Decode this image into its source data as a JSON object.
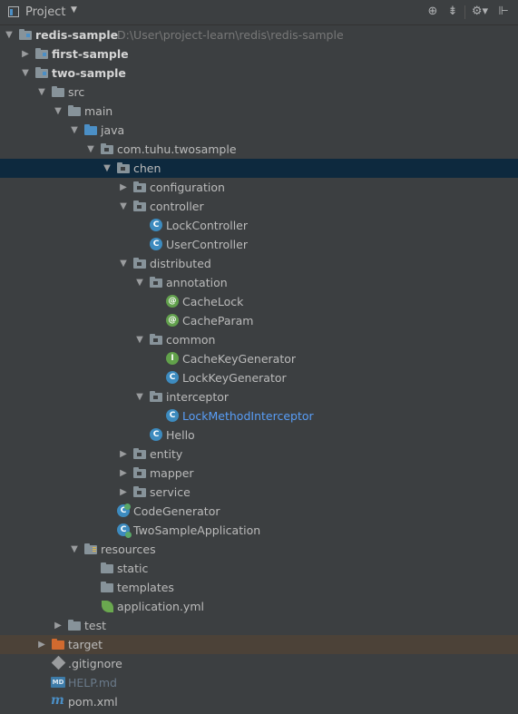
{
  "header": {
    "title": "Project"
  },
  "tree": [
    {
      "label": "redis-sample",
      "hint": "D:\\User\\project-learn\\redis\\redis-sample",
      "bold": true,
      "arrow": "down",
      "icon": "module-folder"
    },
    {
      "label": "first-sample",
      "bold": true,
      "arrow": "right",
      "icon": "module-folder"
    },
    {
      "label": "two-sample",
      "bold": true,
      "arrow": "down",
      "icon": "module-folder"
    },
    {
      "label": "src",
      "arrow": "down",
      "icon": "folder"
    },
    {
      "label": "main",
      "arrow": "down",
      "icon": "folder"
    },
    {
      "label": "java",
      "arrow": "down",
      "icon": "source-folder"
    },
    {
      "label": "com.tuhu.twosample",
      "arrow": "down",
      "icon": "package-icon"
    },
    {
      "label": "chen",
      "arrow": "down",
      "icon": "package-icon",
      "selected": true
    },
    {
      "label": "configuration",
      "arrow": "right",
      "icon": "package-icon"
    },
    {
      "label": "controller",
      "arrow": "down",
      "icon": "package-icon"
    },
    {
      "label": "LockController",
      "icon": "class-icon"
    },
    {
      "label": "UserController",
      "icon": "class-icon"
    },
    {
      "label": "distributed",
      "arrow": "down",
      "icon": "package-icon"
    },
    {
      "label": "annotation",
      "arrow": "down",
      "icon": "package-icon"
    },
    {
      "label": "CacheLock",
      "icon": "annotation-icon"
    },
    {
      "label": "CacheParam",
      "icon": "annotation-icon"
    },
    {
      "label": "common",
      "arrow": "down",
      "icon": "package-icon"
    },
    {
      "label": "CacheKeyGenerator",
      "icon": "interface-icon"
    },
    {
      "label": "LockKeyGenerator",
      "icon": "class-icon"
    },
    {
      "label": "interceptor",
      "arrow": "down",
      "icon": "package-icon"
    },
    {
      "label": "LockMethodInterceptor",
      "icon": "class-icon",
      "link": true
    },
    {
      "label": "Hello",
      "icon": "class-icon"
    },
    {
      "label": "entity",
      "arrow": "right",
      "icon": "package-icon"
    },
    {
      "label": "mapper",
      "arrow": "right",
      "icon": "package-icon"
    },
    {
      "label": "service",
      "arrow": "right",
      "icon": "package-icon"
    },
    {
      "label": "CodeGenerator",
      "icon": "class-generated-icon"
    },
    {
      "label": "TwoSampleApplication",
      "icon": "spring-boot-class-icon"
    },
    {
      "label": "resources",
      "arrow": "down",
      "icon": "resources-folder"
    },
    {
      "label": "static",
      "icon": "folder"
    },
    {
      "label": "templates",
      "icon": "folder"
    },
    {
      "label": "application.yml",
      "icon": "spring-config-icon"
    },
    {
      "label": "test",
      "arrow": "right",
      "icon": "folder"
    },
    {
      "label": "target",
      "arrow": "right",
      "icon": "excluded-folder",
      "excluded": true
    },
    {
      "label": ".gitignore",
      "icon": "gitignore-icon"
    },
    {
      "label": "HELP.md",
      "icon": "markdown-icon",
      "dim": true
    },
    {
      "label": "pom.xml",
      "icon": "maven-icon"
    }
  ]
}
